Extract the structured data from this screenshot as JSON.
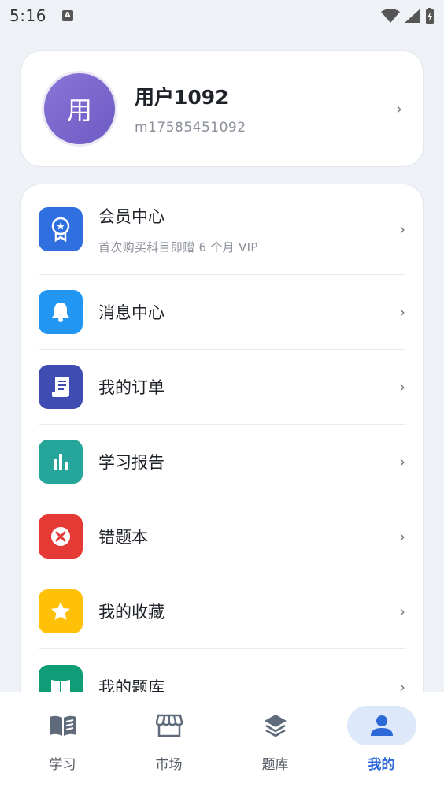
{
  "status_bar": {
    "time": "5:16",
    "notification_badge": "A"
  },
  "profile": {
    "avatar_char": "用",
    "name": "用户1092",
    "account": "m17585451092"
  },
  "menu": {
    "items": [
      {
        "label": "会员中心",
        "sub": "首次购买科目即赠 6 个月 VIP",
        "icon": "award-icon",
        "color": "#2f6fe0"
      },
      {
        "label": "消息中心",
        "icon": "bell-icon",
        "color": "#2196f3"
      },
      {
        "label": "我的订单",
        "icon": "receipt-icon",
        "color": "#3f4db3"
      },
      {
        "label": "学习报告",
        "icon": "bar-chart-icon",
        "color": "#26a69a"
      },
      {
        "label": "错题本",
        "icon": "error-icon",
        "color": "#e53935"
      },
      {
        "label": "我的收藏",
        "icon": "star-icon",
        "color": "#ffc107"
      },
      {
        "label": "我的题库",
        "icon": "book-icon",
        "color": "#0f9d78"
      }
    ]
  },
  "bottom_nav": {
    "items": [
      {
        "label": "学习",
        "icon": "book-open-icon"
      },
      {
        "label": "市场",
        "icon": "store-icon"
      },
      {
        "label": "题库",
        "icon": "layers-icon"
      },
      {
        "label": "我的",
        "icon": "person-icon",
        "active": true
      }
    ]
  },
  "colors": {
    "accent": "#2c68d8",
    "background": "#eef1f6"
  }
}
